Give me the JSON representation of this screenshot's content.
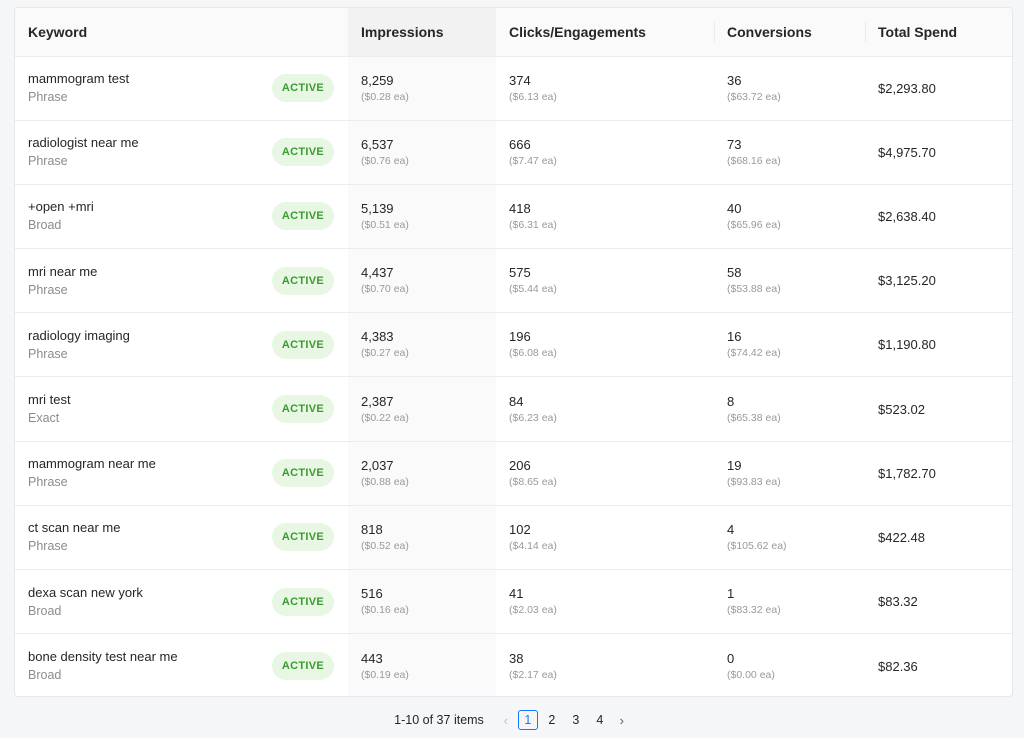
{
  "table": {
    "columns": [
      "Keyword",
      "Impressions",
      "Clicks/Engagements",
      "Conversions",
      "Total Spend"
    ],
    "status_label": "ACTIVE",
    "rows": [
      {
        "keyword": "mammogram test",
        "match": "Phrase",
        "impressions": "8,259",
        "impressions_ea": "($0.28 ea)",
        "clicks": "374",
        "clicks_ea": "($6.13 ea)",
        "conversions": "36",
        "conversions_ea": "($63.72 ea)",
        "spend": "$2,293.80"
      },
      {
        "keyword": "radiologist near me",
        "match": "Phrase",
        "impressions": "6,537",
        "impressions_ea": "($0.76 ea)",
        "clicks": "666",
        "clicks_ea": "($7.47 ea)",
        "conversions": "73",
        "conversions_ea": "($68.16 ea)",
        "spend": "$4,975.70"
      },
      {
        "keyword": "+open +mri",
        "match": "Broad",
        "impressions": "5,139",
        "impressions_ea": "($0.51 ea)",
        "clicks": "418",
        "clicks_ea": "($6.31 ea)",
        "conversions": "40",
        "conversions_ea": "($65.96 ea)",
        "spend": "$2,638.40"
      },
      {
        "keyword": "mri near me",
        "match": "Phrase",
        "impressions": "4,437",
        "impressions_ea": "($0.70 ea)",
        "clicks": "575",
        "clicks_ea": "($5.44 ea)",
        "conversions": "58",
        "conversions_ea": "($53.88 ea)",
        "spend": "$3,125.20"
      },
      {
        "keyword": "radiology imaging",
        "match": "Phrase",
        "impressions": "4,383",
        "impressions_ea": "($0.27 ea)",
        "clicks": "196",
        "clicks_ea": "($6.08 ea)",
        "conversions": "16",
        "conversions_ea": "($74.42 ea)",
        "spend": "$1,190.80"
      },
      {
        "keyword": "mri test",
        "match": "Exact",
        "impressions": "2,387",
        "impressions_ea": "($0.22 ea)",
        "clicks": "84",
        "clicks_ea": "($6.23 ea)",
        "conversions": "8",
        "conversions_ea": "($65.38 ea)",
        "spend": "$523.02"
      },
      {
        "keyword": "mammogram near me",
        "match": "Phrase",
        "impressions": "2,037",
        "impressions_ea": "($0.88 ea)",
        "clicks": "206",
        "clicks_ea": "($8.65 ea)",
        "conversions": "19",
        "conversions_ea": "($93.83 ea)",
        "spend": "$1,782.70"
      },
      {
        "keyword": "ct scan near me",
        "match": "Phrase",
        "impressions": "818",
        "impressions_ea": "($0.52 ea)",
        "clicks": "102",
        "clicks_ea": "($4.14 ea)",
        "conversions": "4",
        "conversions_ea": "($105.62 ea)",
        "spend": "$422.48"
      },
      {
        "keyword": "dexa scan new york",
        "match": "Broad",
        "impressions": "516",
        "impressions_ea": "($0.16 ea)",
        "clicks": "41",
        "clicks_ea": "($2.03 ea)",
        "conversions": "1",
        "conversions_ea": "($83.32 ea)",
        "spend": "$83.32"
      },
      {
        "keyword": "bone density test near me",
        "match": "Broad",
        "impressions": "443",
        "impressions_ea": "($0.19 ea)",
        "clicks": "38",
        "clicks_ea": "($2.17 ea)",
        "conversions": "0",
        "conversions_ea": "($0.00 ea)",
        "spend": "$82.36"
      }
    ]
  },
  "pagination": {
    "summary": "1-10 of 37 items",
    "prev_icon": "‹",
    "next_icon": "›",
    "pages": [
      "1",
      "2",
      "3",
      "4"
    ],
    "current": "1"
  },
  "colors": {
    "badge_bg": "#e8f6e4",
    "badge_text": "#3b9b2e",
    "active_page": "#1677ff"
  }
}
